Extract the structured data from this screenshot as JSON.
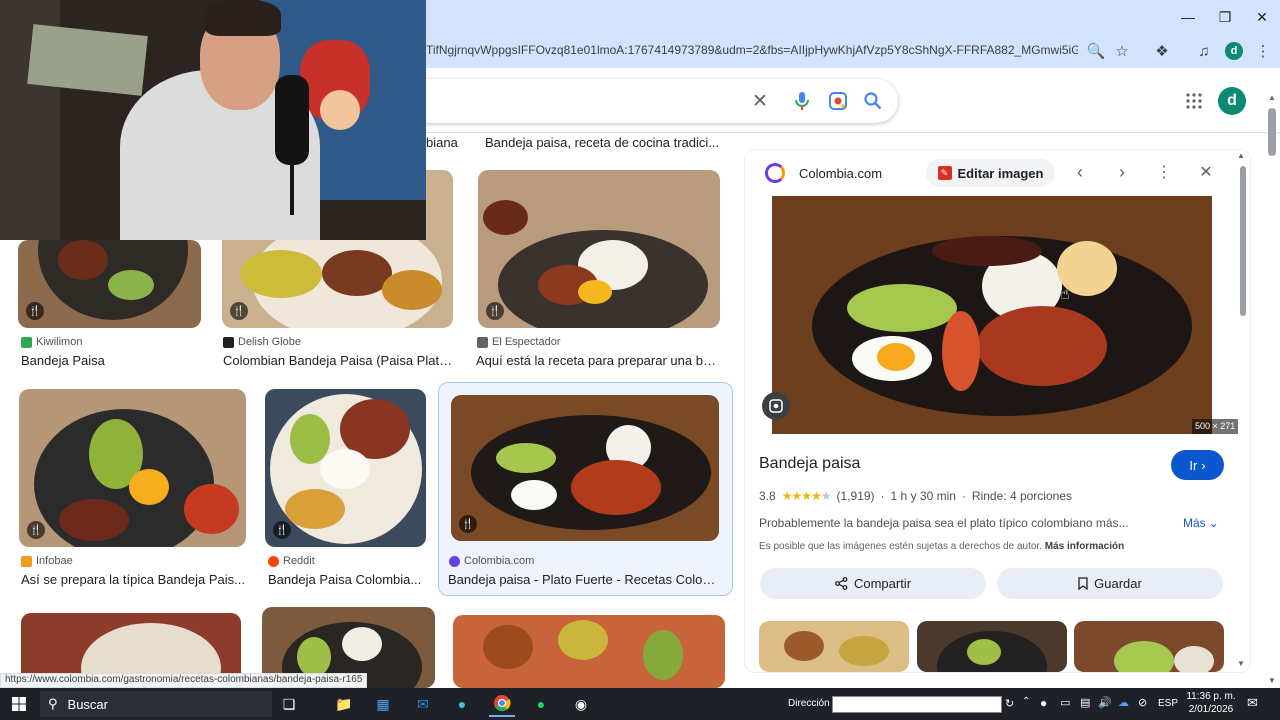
{
  "browser": {
    "url": "TifNgjrnqvWppgsIFFOvzq81e01lmoA:1767414973789&udm=2&fbs=AIIjpHywKhjAfVzp5Y8cShNgX-FFRFA882_MGmwi5iGmSp8NU...",
    "profile_initial": "d",
    "status_url": "https://www.colombia.com/gastronomia/recetas-colombianas/bandeja-paisa-r165"
  },
  "top_row": {
    "left_title_fragment": "biana",
    "right_title": "Bandeja paisa, receta de cocina tradici..."
  },
  "results": [
    {
      "source": "Kiwilimon",
      "title": "Bandeja Paisa",
      "fav_color": "#2fa84f"
    },
    {
      "source": "Delish Globe",
      "title": "Colombian Bandeja Paisa (Paisa Platt...",
      "fav_color": "#202124"
    },
    {
      "source": "El Espectador",
      "title": "Aquí está la receta para preparar una ba...",
      "fav_color": "#5f6368"
    },
    {
      "source": "Infobae",
      "title": "Así se prepara la típica Bandeja Pais...",
      "fav_color": "#f29c1f"
    },
    {
      "source": "Reddit",
      "title": "Bandeja Paisa Colombia...",
      "fav_color": "#ff4500"
    },
    {
      "source": "Colombia.com",
      "title": "Bandeja paisa - Plato Fuerte - Recetas Colom...",
      "fav_color": "#6a3de8"
    }
  ],
  "panel": {
    "source": "Colombia.com",
    "edit_label": "Editar imagen",
    "dimensions": "500 × 271",
    "title": "Bandeja paisa",
    "go_label": "Ir",
    "rating": "3.8",
    "rating_stars": 3.8,
    "reviews": "(1,919)",
    "time": "1 h y 30 min",
    "servings": "Rinde: 4 porciones",
    "description": "Probablemente la bandeja paisa sea el plato típico colombiano más...",
    "more_label": "Más",
    "copyright": "Es posible que las imágenes estén sujetas a derechos de autor.",
    "more_info": "Más información",
    "share_label": "Compartir",
    "save_label": "Guardar"
  },
  "taskbar": {
    "search_placeholder": "Buscar",
    "address_label": "Dirección",
    "language": "ESP",
    "time": "11:36 p. m.",
    "date": "2/01/2026"
  },
  "colors": {
    "chrome_frame": "#d3e3fd",
    "accent_blue": "#0b57d0",
    "selected_outline": "#a8c7fa"
  }
}
